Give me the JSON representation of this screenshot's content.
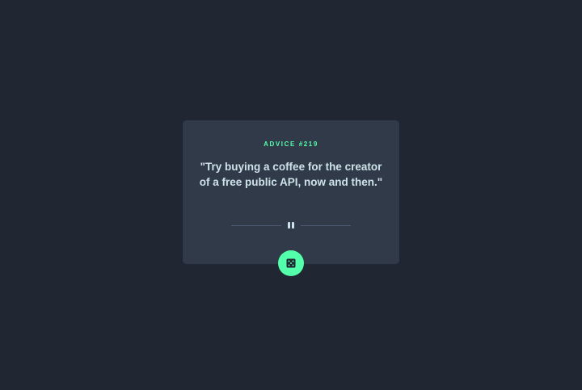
{
  "advice": {
    "label": "ADVICE #219",
    "quote": "\"Try buying a coffee for the creator of a free public API, now and then.\""
  },
  "divider": {
    "icon": "pause-icon"
  },
  "button": {
    "icon": "dice-icon"
  },
  "colors": {
    "background": "#202632",
    "card": "#313a48",
    "accent": "#53ffaa",
    "text": "#cee3e9",
    "divider": "#4f5d74"
  }
}
